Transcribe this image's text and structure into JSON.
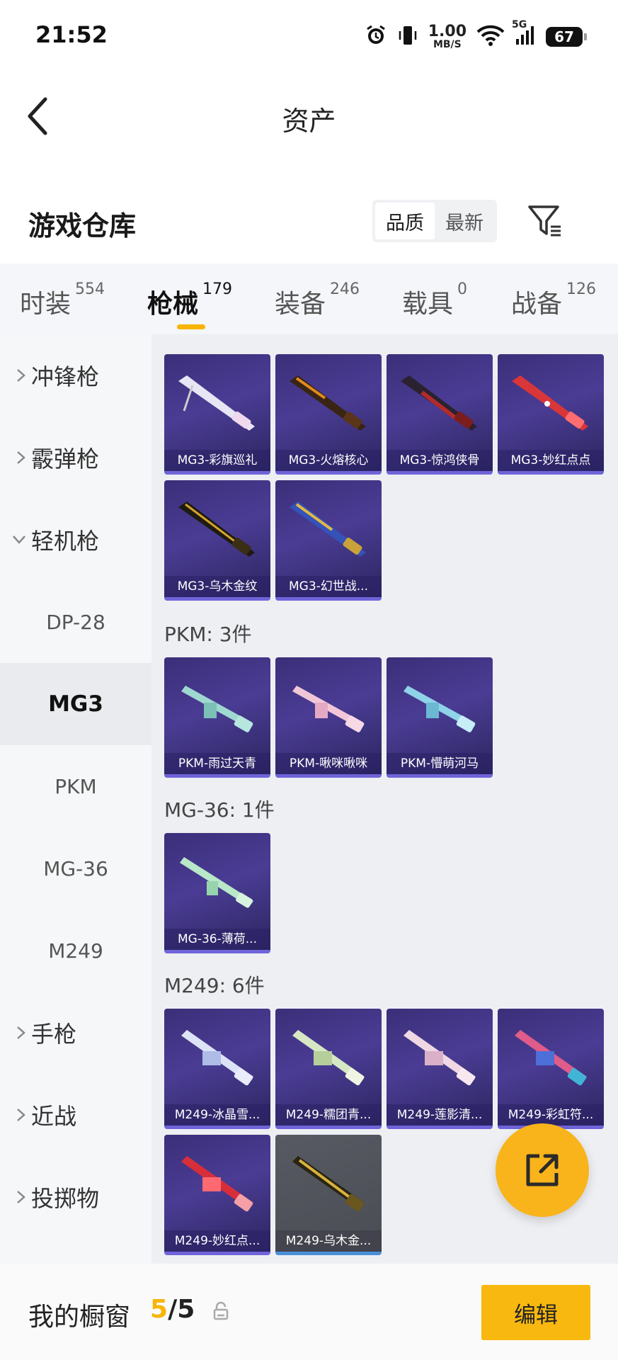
{
  "status_bar": {
    "time": "21:52",
    "net_speed_value": "1.00",
    "net_speed_unit": "MB/S",
    "network": "5G",
    "battery": "67",
    "icons": [
      "alarm-icon",
      "vibrate-icon",
      "wifi-icon",
      "signal-icon",
      "battery-icon"
    ]
  },
  "header": {
    "title": "资产",
    "back_icon": "back-arrow-icon"
  },
  "section": {
    "title": "游戏仓库",
    "sort_options": [
      "品质",
      "最新"
    ],
    "sort_selected": "品质",
    "filter_icon": "filter-icon"
  },
  "tabs": [
    {
      "label": "时装",
      "count": "554"
    },
    {
      "label": "枪械",
      "count": "179",
      "active": true
    },
    {
      "label": "装备",
      "count": "246"
    },
    {
      "label": "载具",
      "count": "0"
    },
    {
      "label": "战备",
      "count": "126"
    }
  ],
  "sidebar": [
    {
      "label": "冲锋枪",
      "type": "category",
      "expanded": false
    },
    {
      "label": "霰弹枪",
      "type": "category",
      "expanded": false
    },
    {
      "label": "轻机枪",
      "type": "category",
      "expanded": true
    },
    {
      "label": "DP-28",
      "type": "sub"
    },
    {
      "label": "MG3",
      "type": "sub",
      "selected": true
    },
    {
      "label": "PKM",
      "type": "sub"
    },
    {
      "label": "MG-36",
      "type": "sub"
    },
    {
      "label": "M249",
      "type": "sub"
    },
    {
      "label": "手枪",
      "type": "category",
      "expanded": false
    },
    {
      "label": "近战",
      "type": "category",
      "expanded": false
    },
    {
      "label": "投掷物",
      "type": "category",
      "expanded": false
    }
  ],
  "groups": [
    {
      "title": "",
      "items": [
        "MG3-彩旗巡礼",
        "MG3-火熔核心",
        "MG3-惊鸿侠骨",
        "MG3-妙红点点",
        "MG3-乌木金纹",
        "MG3-幻世战..."
      ]
    },
    {
      "title": "PKM: 3件",
      "items": [
        "PKM-雨过天青",
        "PKM-啾咪啾咪",
        "PKM-懵萌河马"
      ]
    },
    {
      "title": "MG-36: 1件",
      "items": [
        "MG-36-薄荷..."
      ]
    },
    {
      "title": "M249: 6件",
      "items": [
        "M249-冰晶雪...",
        "M249-糯团青...",
        "M249-莲影清...",
        "M249-彩虹符...",
        "M249-妙红点...",
        "M249-乌木金..."
      ]
    }
  ],
  "fab": {
    "icon": "share-external-icon"
  },
  "bottom": {
    "showcase_label": "我的橱窗",
    "count_current": "5",
    "count_sep": "/",
    "count_total": "5",
    "lock_icon": "lock-icon",
    "edit_label": "编辑"
  },
  "colors": {
    "accent": "#f7b500",
    "card_bg": "#3b2f79",
    "card_border": "#6f64d9"
  }
}
